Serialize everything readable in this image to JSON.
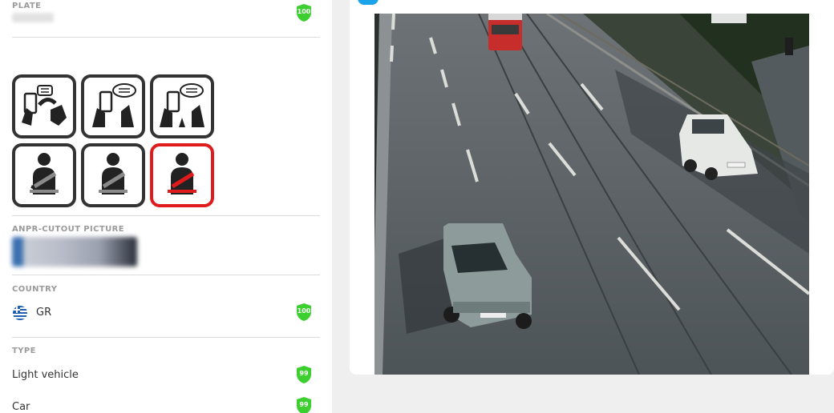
{
  "plate": {
    "label": "PLATE",
    "score": "100"
  },
  "seatbelt_icons": [
    {
      "name": "phone-handoff-icon",
      "alert": false
    },
    {
      "name": "phone-talk-hands-icon",
      "alert": false
    },
    {
      "name": "phone-talk-hands-alt-icon",
      "alert": false
    },
    {
      "name": "seatbelt-icon",
      "alert": false
    },
    {
      "name": "seatbelt-icon",
      "alert": false
    },
    {
      "name": "seatbelt-red-icon",
      "alert": true
    }
  ],
  "anpr": {
    "label": "ANPR-CUTOUT PICTURE"
  },
  "country": {
    "label": "COUNTRY",
    "value": "GR",
    "score": "100"
  },
  "type": {
    "label": "TYPE",
    "rows": [
      {
        "value": "Light vehicle",
        "score": "99"
      },
      {
        "value": "Car",
        "score": "99"
      }
    ]
  },
  "colors": {
    "shield_green": "#3ccf2f",
    "alert_red": "#e01b1b",
    "logo_blue": "#1aa3e8"
  }
}
